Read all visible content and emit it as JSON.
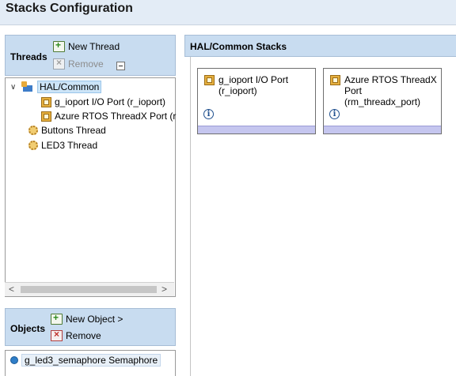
{
  "header": {
    "title": "Stacks Configuration"
  },
  "threads": {
    "label": "Threads",
    "new_thread": "New Thread",
    "remove": "Remove",
    "tree": [
      {
        "label": "HAL/Common",
        "icon": "hal-icon",
        "expanded": true,
        "selected": true
      },
      {
        "label": "g_ioport I/O Port (r_ioport)",
        "icon": "module-icon"
      },
      {
        "label": "Azure RTOS ThreadX Port (r",
        "icon": "module-icon"
      },
      {
        "label": "Buttons Thread",
        "icon": "gear-icon"
      },
      {
        "label": "LED3 Thread",
        "icon": "gear-icon"
      }
    ]
  },
  "objects": {
    "label": "Objects",
    "new_object": "New Object >",
    "remove": "Remove",
    "items": [
      {
        "label": "g_led3_semaphore Semaphore",
        "icon": "semaphore-icon"
      }
    ]
  },
  "stacks": {
    "title": "HAL/Common Stacks",
    "cards": [
      {
        "title": "g_ioport I/O Port (r_ioport)",
        "icon": "module-icon",
        "info_glyph": "i"
      },
      {
        "title": "Azure RTOS ThreadX Port (rm_threadx_port)",
        "icon": "module-icon",
        "info_glyph": "i"
      }
    ]
  },
  "scrollbar": {
    "left_arrow": "<",
    "right_arrow": ">"
  },
  "colors": {
    "header_bg": "#c8dcf0",
    "card_band": "#c5c6ef",
    "title_bg": "#e3ecf6"
  }
}
